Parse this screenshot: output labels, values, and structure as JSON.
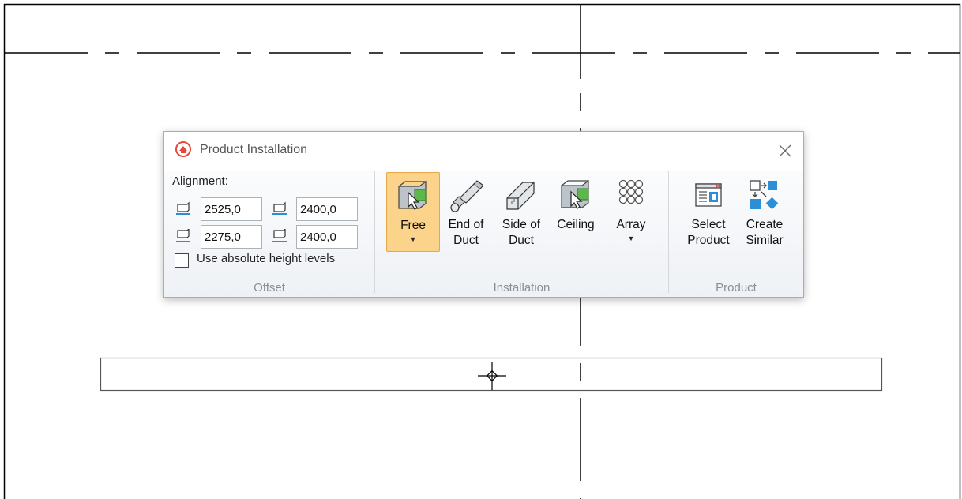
{
  "dialog": {
    "title": "Product Installation",
    "close_glyph": "✕",
    "accent_color": "#e8453c"
  },
  "offset": {
    "alignment_label": "Alignment:",
    "fields": {
      "top_left": "2525,0",
      "top_right": "2400,0",
      "bottom_left": "2275,0",
      "bottom_right": "2400,0"
    },
    "absolute_height_label": "Use absolute height levels",
    "absolute_height_checked": false,
    "group_label": "Offset"
  },
  "installation": {
    "buttons": {
      "free": {
        "line1": "Free",
        "dropdown": "▼",
        "active": true,
        "icon": "free-placement-icon"
      },
      "end_of_duct": {
        "line1": "End of",
        "line2": "Duct",
        "icon": "end-of-duct-icon"
      },
      "side_of_duct": {
        "line1": "Side of",
        "line2": "Duct",
        "icon": "side-of-duct-icon"
      },
      "ceiling": {
        "line1": "Ceiling",
        "icon": "ceiling-icon"
      },
      "array": {
        "line1": "Array",
        "dropdown": "▼",
        "icon": "array-icon"
      }
    },
    "group_label": "Installation"
  },
  "product": {
    "buttons": {
      "select_product": {
        "line1": "Select",
        "line2": "Product",
        "icon": "select-product-icon"
      },
      "create_similar": {
        "line1": "Create",
        "line2": "Similar",
        "icon": "create-similar-icon"
      }
    },
    "group_label": "Product"
  },
  "colors": {
    "active_button_fill": "#fcd38a",
    "active_button_border": "#e6a844",
    "icon_blue": "#2b8fd8",
    "icon_green": "#5cb84a",
    "canvas_line": "#000000"
  }
}
